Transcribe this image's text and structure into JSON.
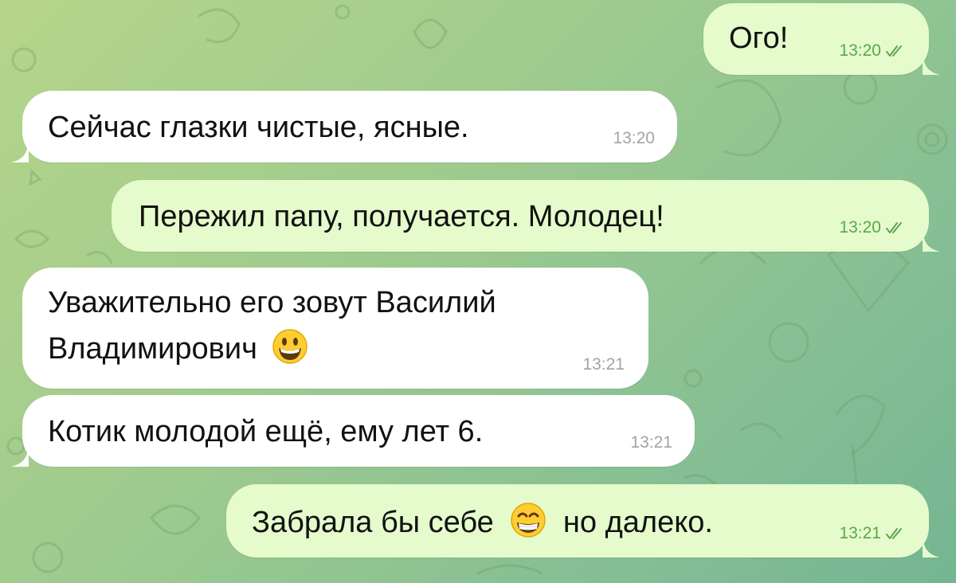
{
  "chat": {
    "messages": [
      {
        "id": "m1",
        "direction": "outgoing",
        "text": "Ого!",
        "time": "13:20",
        "status": "read-double-check"
      },
      {
        "id": "m2",
        "direction": "incoming",
        "text": "Сейчас глазки чистые, ясные.",
        "time": "13:20"
      },
      {
        "id": "m3",
        "direction": "outgoing",
        "text": "Пережил папу, получается. Молодец!",
        "time": "13:20",
        "status": "read-double-check"
      },
      {
        "id": "m4",
        "direction": "incoming",
        "line1": "Уважительно его зовут Василий",
        "line2": "Владимирович",
        "emoji": "grinning-face-emoji",
        "time": "13:21"
      },
      {
        "id": "m5",
        "direction": "incoming",
        "text": "Котик молодой ещё, ему лет 6.",
        "time": "13:21"
      },
      {
        "id": "m6",
        "direction": "outgoing",
        "text_before": "Забрала бы себе",
        "emoji": "beaming-face-emoji",
        "text_after": "но далеко.",
        "time": "13:21",
        "status": "read-double-check"
      }
    ]
  },
  "colors": {
    "incoming_bubble": "#ffffff",
    "outgoing_bubble": "#e5fbcb",
    "outgoing_meta": "#5aa64f",
    "incoming_meta": "#a3a3a3",
    "background_start": "#b5d58a",
    "background_end": "#74b592"
  }
}
